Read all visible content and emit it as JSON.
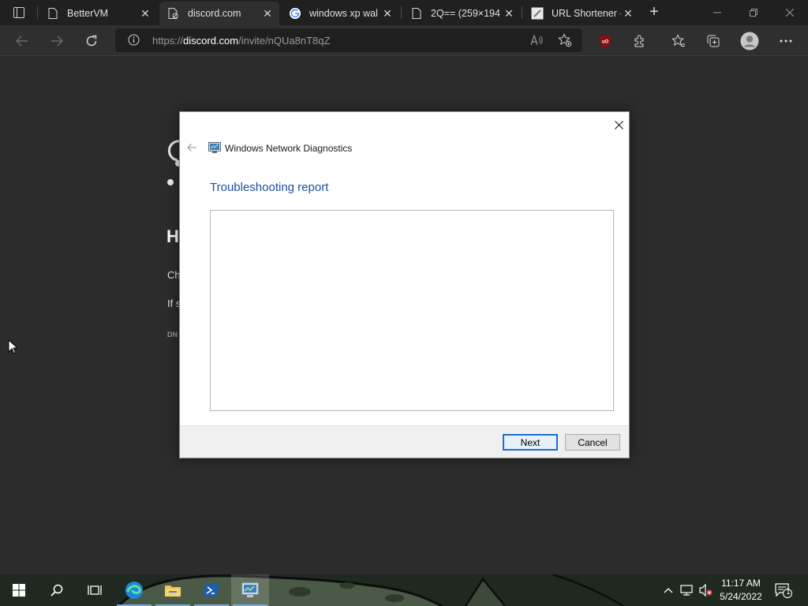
{
  "browser": {
    "tabs": [
      {
        "title": "BetterVM",
        "icon": "page-icon",
        "active": false
      },
      {
        "title": "discord.com",
        "icon": "page-blocked-icon",
        "active": true
      },
      {
        "title": "windows xp wal",
        "icon": "google-icon",
        "active": false
      },
      {
        "title": "2Q== (259×194",
        "icon": "page-icon",
        "active": false
      },
      {
        "title": "URL Shortener -",
        "icon": "link-icon",
        "active": false
      }
    ],
    "close_glyph": "✕",
    "new_tab_glyph": "+",
    "url_prefix": "https://",
    "url_host": "discord.com",
    "url_path": "/invite/nQUa8nT8qZ"
  },
  "page": {
    "heading_fragment": "H",
    "line1_fragment": "Ch",
    "line2_fragment": "If s",
    "line3_fragment": "DN"
  },
  "dialog": {
    "app_title": "Windows Network Diagnostics",
    "heading": "Troubleshooting report",
    "next_label": "Next",
    "cancel_label": "Cancel"
  },
  "taskbar": {
    "time": "11:17 AM",
    "date": "5/24/2022",
    "notification_count": "1"
  },
  "colors": {
    "dialog_heading": "#1a4fa0",
    "primary_button_border": "#1d6fcf",
    "page_background": "#2c2c2c"
  }
}
